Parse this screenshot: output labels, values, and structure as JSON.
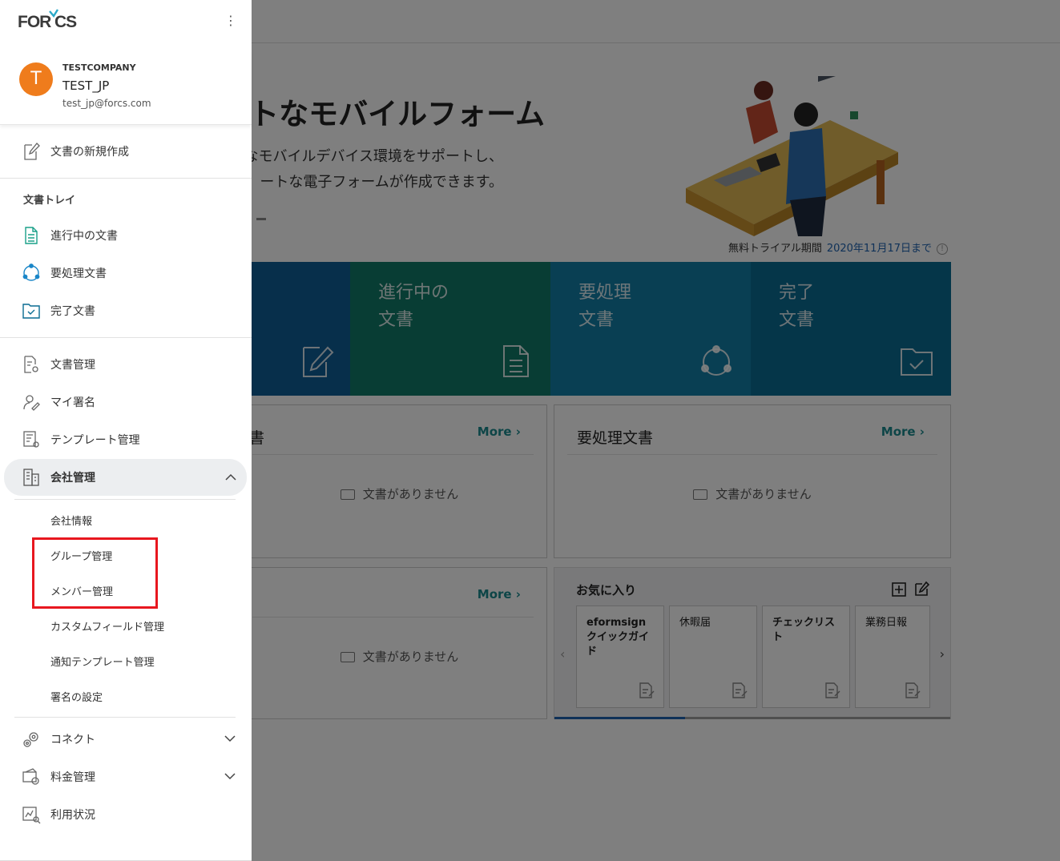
{
  "brand": {
    "logo_text": "FORCS"
  },
  "profile": {
    "avatar_letter": "T",
    "company": "TESTCOMPANY",
    "username": "TEST_JP",
    "email": "test_jp@forcs.com"
  },
  "menu": {
    "new_document": "文書の新規作成",
    "tray_heading": "文書トレイ",
    "tray": [
      "進行中の文書",
      "要処理文書",
      "完了文書"
    ],
    "management": [
      "文書管理",
      "マイ署名",
      "テンプレート管理"
    ],
    "company_admin": "会社管理",
    "company_sub": [
      "会社情報",
      "グループ管理",
      "メンバー管理",
      "カスタムフィールド管理",
      "通知テンプレート管理",
      "署名の設定"
    ],
    "connect": "コネクト",
    "billing": "料金管理",
    "usage": "利用状況"
  },
  "hero": {
    "title": "ートなモバイルフォーム",
    "desc_line1": "なモバイルデバイス環境をサポートし、",
    "desc_line2": "ートな電子フォームが作成できます。"
  },
  "trial": {
    "label": "無料トライアル期間",
    "date": "2020年11月17日まで",
    "info": "!"
  },
  "tiles": [
    {
      "label": "",
      "color": "#0e5f96"
    },
    {
      "label": "進行中の\n文書",
      "color": "#107a68"
    },
    {
      "label": "要処理\n文書",
      "color": "#127fa6"
    },
    {
      "label": "完了\n文書",
      "color": "#0a6c92"
    }
  ],
  "panels": {
    "in_progress": {
      "title": "書",
      "more": "More ›",
      "empty": "文書がありません"
    },
    "action_needed": {
      "title": "要処理文書",
      "more": "More ›",
      "empty": "文書がありません"
    },
    "completed": {
      "title": "",
      "more": "More ›",
      "empty": "文書がありません"
    }
  },
  "favorites": {
    "title": "お気に入り",
    "items": [
      "eformsignクイックガイド",
      "休暇届",
      "チェックリスト",
      "業務日報"
    ],
    "prev": "‹",
    "next": "›",
    "progress": 0.33
  },
  "colors": {
    "accent": "#1b8a8f",
    "avatar": "#ef7c1c",
    "highlight": "#e8171f",
    "link": "#1e62b0"
  }
}
